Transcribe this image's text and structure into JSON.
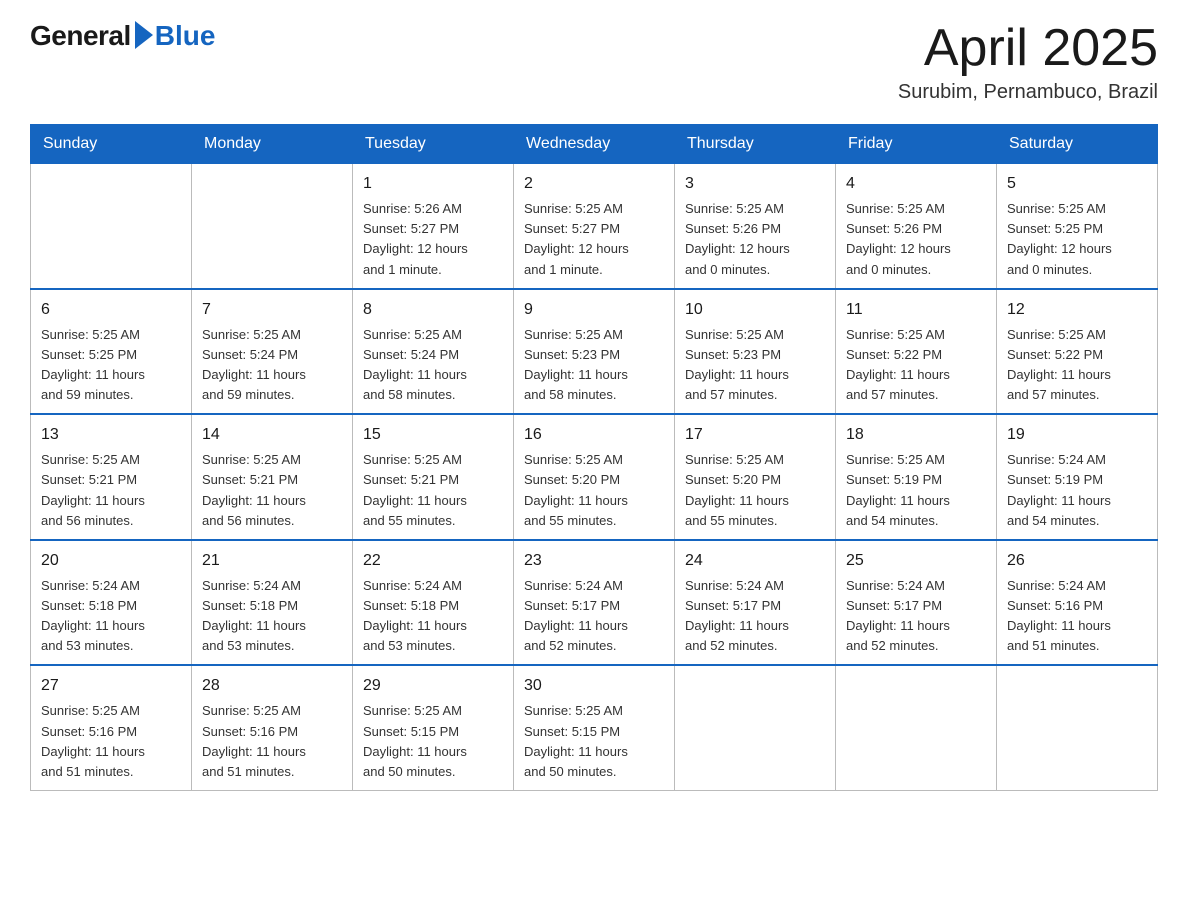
{
  "logo": {
    "general": "General",
    "blue": "Blue"
  },
  "title": {
    "month_year": "April 2025",
    "location": "Surubim, Pernambuco, Brazil"
  },
  "headers": [
    "Sunday",
    "Monday",
    "Tuesday",
    "Wednesday",
    "Thursday",
    "Friday",
    "Saturday"
  ],
  "weeks": [
    [
      {
        "day": "",
        "info": ""
      },
      {
        "day": "",
        "info": ""
      },
      {
        "day": "1",
        "info": "Sunrise: 5:26 AM\nSunset: 5:27 PM\nDaylight: 12 hours\nand 1 minute."
      },
      {
        "day": "2",
        "info": "Sunrise: 5:25 AM\nSunset: 5:27 PM\nDaylight: 12 hours\nand 1 minute."
      },
      {
        "day": "3",
        "info": "Sunrise: 5:25 AM\nSunset: 5:26 PM\nDaylight: 12 hours\nand 0 minutes."
      },
      {
        "day": "4",
        "info": "Sunrise: 5:25 AM\nSunset: 5:26 PM\nDaylight: 12 hours\nand 0 minutes."
      },
      {
        "day": "5",
        "info": "Sunrise: 5:25 AM\nSunset: 5:25 PM\nDaylight: 12 hours\nand 0 minutes."
      }
    ],
    [
      {
        "day": "6",
        "info": "Sunrise: 5:25 AM\nSunset: 5:25 PM\nDaylight: 11 hours\nand 59 minutes."
      },
      {
        "day": "7",
        "info": "Sunrise: 5:25 AM\nSunset: 5:24 PM\nDaylight: 11 hours\nand 59 minutes."
      },
      {
        "day": "8",
        "info": "Sunrise: 5:25 AM\nSunset: 5:24 PM\nDaylight: 11 hours\nand 58 minutes."
      },
      {
        "day": "9",
        "info": "Sunrise: 5:25 AM\nSunset: 5:23 PM\nDaylight: 11 hours\nand 58 minutes."
      },
      {
        "day": "10",
        "info": "Sunrise: 5:25 AM\nSunset: 5:23 PM\nDaylight: 11 hours\nand 57 minutes."
      },
      {
        "day": "11",
        "info": "Sunrise: 5:25 AM\nSunset: 5:22 PM\nDaylight: 11 hours\nand 57 minutes."
      },
      {
        "day": "12",
        "info": "Sunrise: 5:25 AM\nSunset: 5:22 PM\nDaylight: 11 hours\nand 57 minutes."
      }
    ],
    [
      {
        "day": "13",
        "info": "Sunrise: 5:25 AM\nSunset: 5:21 PM\nDaylight: 11 hours\nand 56 minutes."
      },
      {
        "day": "14",
        "info": "Sunrise: 5:25 AM\nSunset: 5:21 PM\nDaylight: 11 hours\nand 56 minutes."
      },
      {
        "day": "15",
        "info": "Sunrise: 5:25 AM\nSunset: 5:21 PM\nDaylight: 11 hours\nand 55 minutes."
      },
      {
        "day": "16",
        "info": "Sunrise: 5:25 AM\nSunset: 5:20 PM\nDaylight: 11 hours\nand 55 minutes."
      },
      {
        "day": "17",
        "info": "Sunrise: 5:25 AM\nSunset: 5:20 PM\nDaylight: 11 hours\nand 55 minutes."
      },
      {
        "day": "18",
        "info": "Sunrise: 5:25 AM\nSunset: 5:19 PM\nDaylight: 11 hours\nand 54 minutes."
      },
      {
        "day": "19",
        "info": "Sunrise: 5:24 AM\nSunset: 5:19 PM\nDaylight: 11 hours\nand 54 minutes."
      }
    ],
    [
      {
        "day": "20",
        "info": "Sunrise: 5:24 AM\nSunset: 5:18 PM\nDaylight: 11 hours\nand 53 minutes."
      },
      {
        "day": "21",
        "info": "Sunrise: 5:24 AM\nSunset: 5:18 PM\nDaylight: 11 hours\nand 53 minutes."
      },
      {
        "day": "22",
        "info": "Sunrise: 5:24 AM\nSunset: 5:18 PM\nDaylight: 11 hours\nand 53 minutes."
      },
      {
        "day": "23",
        "info": "Sunrise: 5:24 AM\nSunset: 5:17 PM\nDaylight: 11 hours\nand 52 minutes."
      },
      {
        "day": "24",
        "info": "Sunrise: 5:24 AM\nSunset: 5:17 PM\nDaylight: 11 hours\nand 52 minutes."
      },
      {
        "day": "25",
        "info": "Sunrise: 5:24 AM\nSunset: 5:17 PM\nDaylight: 11 hours\nand 52 minutes."
      },
      {
        "day": "26",
        "info": "Sunrise: 5:24 AM\nSunset: 5:16 PM\nDaylight: 11 hours\nand 51 minutes."
      }
    ],
    [
      {
        "day": "27",
        "info": "Sunrise: 5:25 AM\nSunset: 5:16 PM\nDaylight: 11 hours\nand 51 minutes."
      },
      {
        "day": "28",
        "info": "Sunrise: 5:25 AM\nSunset: 5:16 PM\nDaylight: 11 hours\nand 51 minutes."
      },
      {
        "day": "29",
        "info": "Sunrise: 5:25 AM\nSunset: 5:15 PM\nDaylight: 11 hours\nand 50 minutes."
      },
      {
        "day": "30",
        "info": "Sunrise: 5:25 AM\nSunset: 5:15 PM\nDaylight: 11 hours\nand 50 minutes."
      },
      {
        "day": "",
        "info": ""
      },
      {
        "day": "",
        "info": ""
      },
      {
        "day": "",
        "info": ""
      }
    ]
  ]
}
